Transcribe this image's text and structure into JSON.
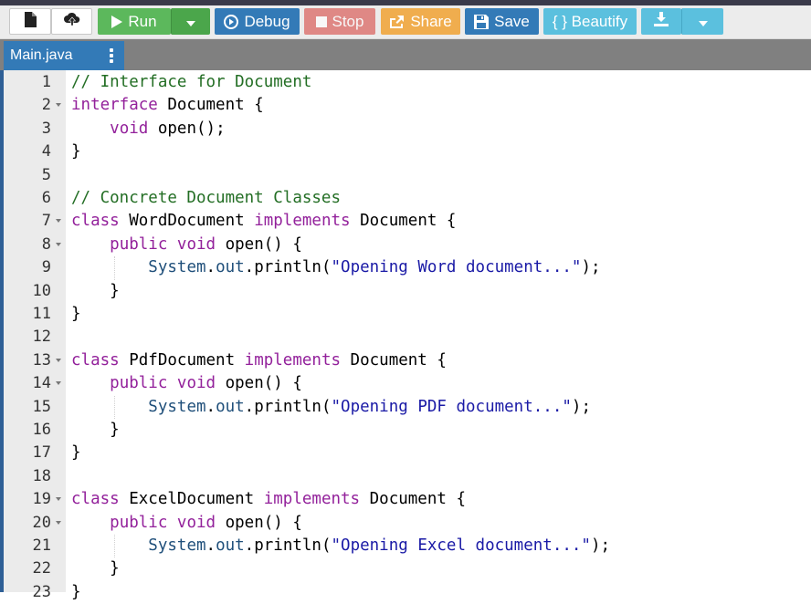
{
  "toolbar": {
    "new_file_icon": "file-icon",
    "upload_icon": "cloud-upload-icon",
    "run_label": "Run",
    "debug_label": "Debug",
    "stop_label": "Stop",
    "share_label": "Share",
    "save_label": "Save",
    "beautify_label": "{ } Beautify"
  },
  "tab": {
    "filename": "Main.java"
  },
  "colors": {
    "run": "#5cb85c",
    "debug": "#337ab7",
    "stop": "#d9534f",
    "share": "#f0ad4e",
    "save": "#337ab7",
    "beautify": "#5bc0de",
    "comment": "#236e24",
    "keyword": "#93219b",
    "string": "#1a1aa6"
  },
  "code": {
    "lines": [
      {
        "n": "1",
        "fold": false,
        "tokens": [
          {
            "t": "cm",
            "v": "// Interface for Document"
          }
        ]
      },
      {
        "n": "2",
        "fold": true,
        "tokens": [
          {
            "t": "kw",
            "v": "interface"
          },
          {
            "t": "pl",
            "v": " Document {"
          }
        ]
      },
      {
        "n": "3",
        "fold": false,
        "tokens": [
          {
            "t": "pl",
            "v": "    "
          },
          {
            "t": "kw",
            "v": "void"
          },
          {
            "t": "pl",
            "v": " open();"
          }
        ]
      },
      {
        "n": "4",
        "fold": false,
        "tokens": [
          {
            "t": "pl",
            "v": "}"
          }
        ]
      },
      {
        "n": "5",
        "fold": false,
        "tokens": []
      },
      {
        "n": "6",
        "fold": false,
        "tokens": [
          {
            "t": "cm",
            "v": "// Concrete Document Classes"
          }
        ]
      },
      {
        "n": "7",
        "fold": true,
        "tokens": [
          {
            "t": "kw",
            "v": "class"
          },
          {
            "t": "pl",
            "v": " WordDocument "
          },
          {
            "t": "kw",
            "v": "implements"
          },
          {
            "t": "pl",
            "v": " Document {"
          }
        ]
      },
      {
        "n": "8",
        "fold": true,
        "tokens": [
          {
            "t": "pl",
            "v": "    "
          },
          {
            "t": "kw",
            "v": "public"
          },
          {
            "t": "pl",
            "v": " "
          },
          {
            "t": "kw",
            "v": "void"
          },
          {
            "t": "pl",
            "v": " open() {"
          }
        ]
      },
      {
        "n": "9",
        "fold": false,
        "tokens": [
          {
            "t": "pl",
            "v": "        "
          },
          {
            "t": "obj",
            "v": "System"
          },
          {
            "t": "pl",
            "v": "."
          },
          {
            "t": "obj",
            "v": "out"
          },
          {
            "t": "pl",
            "v": ".println("
          },
          {
            "t": "str",
            "v": "\"Opening Word document...\""
          },
          {
            "t": "pl",
            "v": ");"
          }
        ]
      },
      {
        "n": "10",
        "fold": false,
        "tokens": [
          {
            "t": "pl",
            "v": "    }"
          }
        ]
      },
      {
        "n": "11",
        "fold": false,
        "tokens": [
          {
            "t": "pl",
            "v": "}"
          }
        ]
      },
      {
        "n": "12",
        "fold": false,
        "tokens": []
      },
      {
        "n": "13",
        "fold": true,
        "tokens": [
          {
            "t": "kw",
            "v": "class"
          },
          {
            "t": "pl",
            "v": " PdfDocument "
          },
          {
            "t": "kw",
            "v": "implements"
          },
          {
            "t": "pl",
            "v": " Document {"
          }
        ]
      },
      {
        "n": "14",
        "fold": true,
        "tokens": [
          {
            "t": "pl",
            "v": "    "
          },
          {
            "t": "kw",
            "v": "public"
          },
          {
            "t": "pl",
            "v": " "
          },
          {
            "t": "kw",
            "v": "void"
          },
          {
            "t": "pl",
            "v": " open() {"
          }
        ]
      },
      {
        "n": "15",
        "fold": false,
        "tokens": [
          {
            "t": "pl",
            "v": "        "
          },
          {
            "t": "obj",
            "v": "System"
          },
          {
            "t": "pl",
            "v": "."
          },
          {
            "t": "obj",
            "v": "out"
          },
          {
            "t": "pl",
            "v": ".println("
          },
          {
            "t": "str",
            "v": "\"Opening PDF document...\""
          },
          {
            "t": "pl",
            "v": ");"
          }
        ]
      },
      {
        "n": "16",
        "fold": false,
        "tokens": [
          {
            "t": "pl",
            "v": "    }"
          }
        ]
      },
      {
        "n": "17",
        "fold": false,
        "tokens": [
          {
            "t": "pl",
            "v": "}"
          }
        ]
      },
      {
        "n": "18",
        "fold": false,
        "tokens": []
      },
      {
        "n": "19",
        "fold": true,
        "tokens": [
          {
            "t": "kw",
            "v": "class"
          },
          {
            "t": "pl",
            "v": " ExcelDocument "
          },
          {
            "t": "kw",
            "v": "implements"
          },
          {
            "t": "pl",
            "v": " Document {"
          }
        ]
      },
      {
        "n": "20",
        "fold": true,
        "tokens": [
          {
            "t": "pl",
            "v": "    "
          },
          {
            "t": "kw",
            "v": "public"
          },
          {
            "t": "pl",
            "v": " "
          },
          {
            "t": "kw",
            "v": "void"
          },
          {
            "t": "pl",
            "v": " open() {"
          }
        ]
      },
      {
        "n": "21",
        "fold": false,
        "tokens": [
          {
            "t": "pl",
            "v": "        "
          },
          {
            "t": "obj",
            "v": "System"
          },
          {
            "t": "pl",
            "v": "."
          },
          {
            "t": "obj",
            "v": "out"
          },
          {
            "t": "pl",
            "v": ".println("
          },
          {
            "t": "str",
            "v": "\"Opening Excel document...\""
          },
          {
            "t": "pl",
            "v": ");"
          }
        ]
      },
      {
        "n": "22",
        "fold": false,
        "tokens": [
          {
            "t": "pl",
            "v": "    }"
          }
        ]
      },
      {
        "n": "23",
        "fold": false,
        "tokens": [
          {
            "t": "pl",
            "v": "}"
          }
        ]
      }
    ]
  }
}
